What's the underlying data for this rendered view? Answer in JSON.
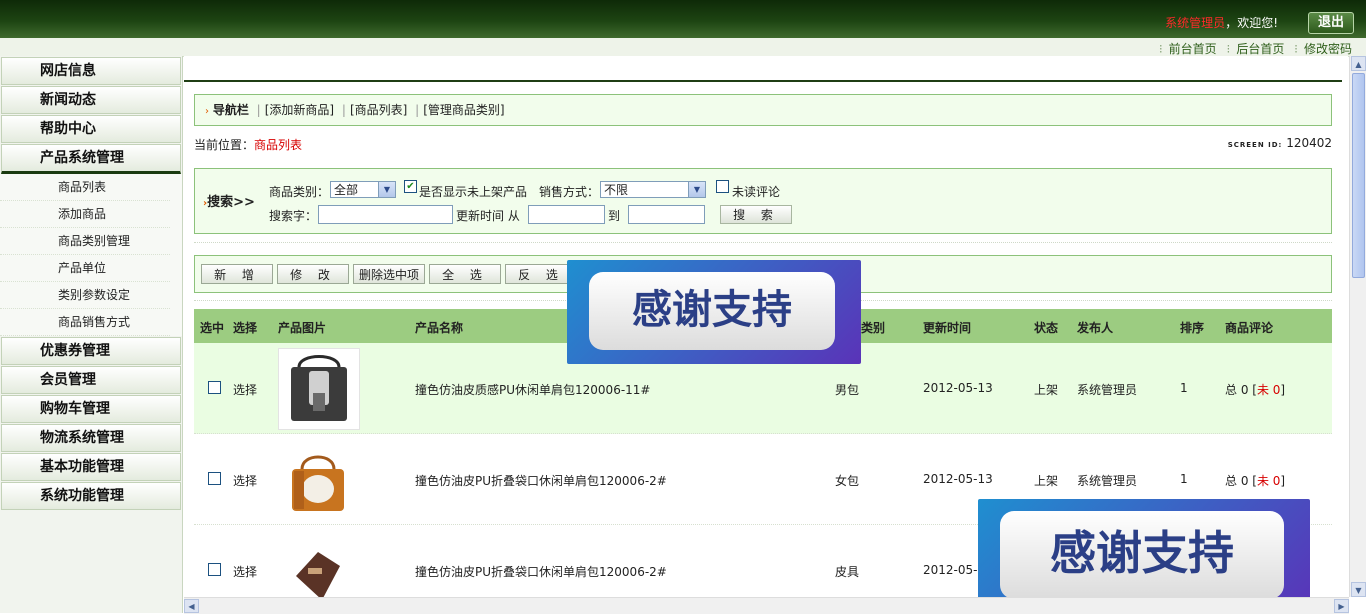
{
  "header": {
    "admin_name": "系统管理员",
    "welcome_text": "，欢迎您!",
    "logout_label": "退出"
  },
  "toplinks": [
    "前台首页",
    "后台首页",
    "修改密码"
  ],
  "sidebar": {
    "items_top": [
      "网店信息",
      "新闻动态",
      "帮助中心",
      "产品系统管理"
    ],
    "submenu": [
      "商品列表",
      "添加商品",
      "商品类别管理",
      "产品单位",
      "类别参数设定",
      "商品销售方式"
    ],
    "items_bottom": [
      "优惠券管理",
      "会员管理",
      "购物车管理",
      "物流系统管理",
      "基本功能管理",
      "系统功能管理"
    ]
  },
  "navbar": {
    "title": "导航栏",
    "links": [
      "[添加新商品]",
      "[商品列表]",
      "[管理商品类别]"
    ]
  },
  "location": {
    "label": "当前位置：",
    "current": "商品列表"
  },
  "screen_id": {
    "label": "SCREEN ID:",
    "value": "120402"
  },
  "search": {
    "title": "搜索>>",
    "category_label": "商品类别：",
    "category_value": "全部",
    "show_offshelf_label": "是否显示未上架产品",
    "sale_method_label": "销售方式：",
    "sale_method_value": "不限",
    "unread_label": "未读评论",
    "keyword_label": "搜索字：",
    "update_time_label": "更新时间 从",
    "to_label": "到",
    "search_button": "搜 索"
  },
  "toolbar": {
    "add": "新 增",
    "edit": "修 改",
    "delete": "删除选中项",
    "select_all": "全 选",
    "invert": "反 选"
  },
  "table": {
    "headers": [
      "选中",
      "选择",
      "产品图片",
      "产品名称",
      "类别",
      "更新时间",
      "状态",
      "发布人",
      "排序",
      "商品评论"
    ],
    "rows": [
      {
        "select": "选择",
        "name": "撞色仿油皮质感PU休闲单肩包120006-11#",
        "category": "男包",
        "date": "2012-05-13",
        "status": "上架",
        "publisher": "系统管理员",
        "order": "1",
        "comment_total": "总 0 [",
        "comment_unread": "未 0",
        "comment_end": "]"
      },
      {
        "select": "选择",
        "name": "撞色仿油皮PU折叠袋口休闲单肩包120006-2#",
        "category": "女包",
        "date": "2012-05-13",
        "status": "上架",
        "publisher": "系统管理员",
        "order": "1",
        "comment_total": "总 0 [",
        "comment_unread": "未 0",
        "comment_end": "]"
      },
      {
        "select": "选择",
        "name": "撞色仿油皮PU折叠袋口休闲单肩包120006-2#",
        "category": "皮具",
        "date": "2012-05-1"
      }
    ]
  },
  "watermark": "感谢支持"
}
